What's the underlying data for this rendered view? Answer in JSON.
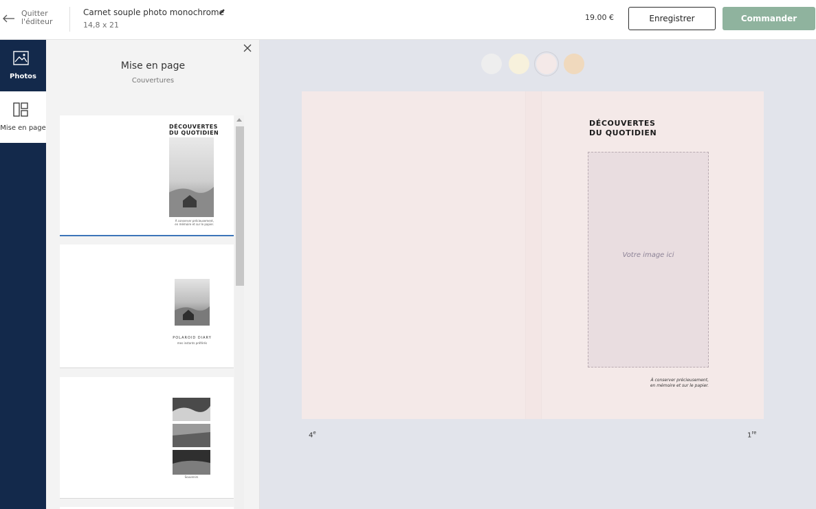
{
  "topbar": {
    "quit_line1": "Quitter",
    "quit_line2": "l'éditeur",
    "project_title": "Carnet souple photo monochrome",
    "project_size": "14,8 x 21",
    "price": "19.00 €",
    "save_label": "Enregistrer",
    "order_label": "Commander",
    "order_color": "#8fb39e"
  },
  "leftnav": {
    "items": [
      {
        "label": "Photos",
        "icon": "image-icon"
      },
      {
        "label": "Mise en page",
        "icon": "layout-icon"
      }
    ],
    "bg_color": "#13294b"
  },
  "panel": {
    "title": "Mise en page",
    "subtitle": "Couvertures",
    "thumbs": [
      {
        "title_l1": "DÉCOUVERTES",
        "title_l2": "DU QUOTIDIEN",
        "cap_l1": "À conserver précieusement,",
        "cap_l2": "en mémoire et sur le papier.",
        "selected": true
      },
      {
        "title": "POLAROID DIARY",
        "caption": "mes instants préférés",
        "selected": false
      },
      {
        "caption": "Souvenirs",
        "selected": false
      }
    ]
  },
  "canvas": {
    "swatches": [
      "#eeeeee",
      "#f7f1dc",
      "#f4e9e8",
      "#f0d9bd"
    ],
    "selected_swatch": 2,
    "cover_title_l1": "DÉCOUVERTES",
    "cover_title_l2": "DU QUOTIDIEN",
    "image_placeholder": "Votre image ici",
    "caption_l1": "À conserver précieusement,",
    "caption_l2": "en mémoire et sur le papier.",
    "page_back": "4",
    "page_back_sup": "e",
    "page_front": "1",
    "page_front_sup": "re"
  }
}
